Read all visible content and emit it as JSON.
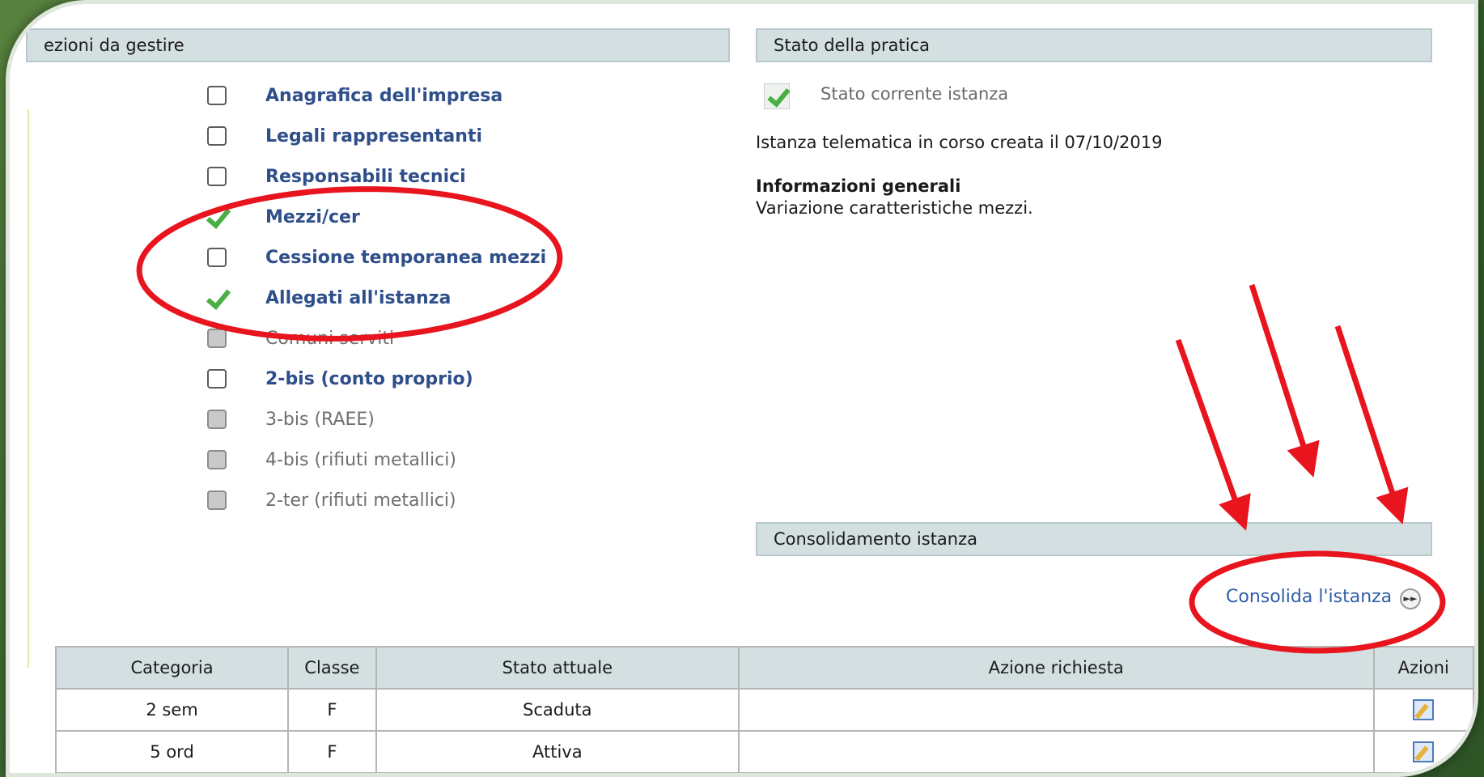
{
  "sections_panel": {
    "header": "ezioni da gestire",
    "items": [
      {
        "label": "Anagrafica dell'impresa",
        "state": "unchecked",
        "enabled": true
      },
      {
        "label": "Legali rappresentanti",
        "state": "unchecked",
        "enabled": true
      },
      {
        "label": "Responsabili tecnici",
        "state": "unchecked",
        "enabled": true
      },
      {
        "label": "Mezzi/cer",
        "state": "checked",
        "enabled": true
      },
      {
        "label": "Cessione temporanea mezzi",
        "state": "unchecked",
        "enabled": true
      },
      {
        "label": "Allegati all'istanza",
        "state": "checked",
        "enabled": true
      },
      {
        "label": "Comuni serviti",
        "state": "disabled",
        "enabled": false
      },
      {
        "label": "2-bis (conto proprio)",
        "state": "unchecked",
        "enabled": true
      },
      {
        "label": "3-bis (RAEE)",
        "state": "disabled",
        "enabled": false
      },
      {
        "label": "4-bis (rifiuti metallici)",
        "state": "disabled",
        "enabled": false
      },
      {
        "label": "2-ter (rifiuti metallici)",
        "state": "disabled",
        "enabled": false
      }
    ]
  },
  "stato_panel": {
    "header": "Stato della pratica",
    "current_label": "Stato corrente istanza",
    "status_text": "Istanza telematica in corso creata il 07/10/2019",
    "info_title": "Informazioni generali",
    "info_text": "Variazione caratteristiche mezzi."
  },
  "consolidamento": {
    "header": "Consolidamento istanza",
    "link_label": "Consolida l'istanza",
    "icon": "play-forward-icon"
  },
  "table": {
    "headers": [
      "Categoria",
      "Classe",
      "Stato attuale",
      "Azione richiesta",
      "Azioni"
    ],
    "rows": [
      [
        "2 sem",
        "F",
        "Scaduta",
        "",
        "edit-icon"
      ],
      [
        "5 ord",
        "F",
        "Attiva",
        "",
        "edit-icon"
      ]
    ]
  },
  "colors": {
    "header_bg": "#d3dfe0",
    "link_blue": "#2f4f8a",
    "check_green": "#4aaf42",
    "annotation_red": "#e8141e",
    "frame_green": "#3f6b32"
  }
}
